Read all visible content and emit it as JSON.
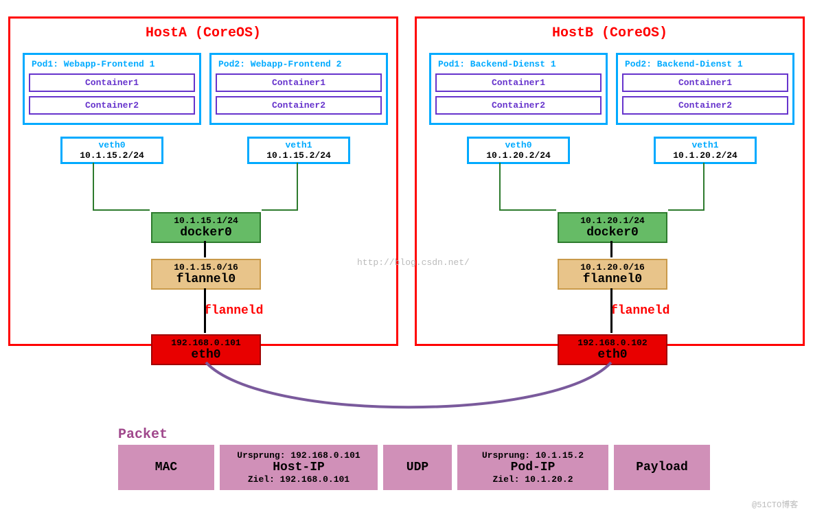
{
  "hostA": {
    "title": "HostA (CoreOS)",
    "pod1": {
      "title": "Pod1: Webapp-Frontend 1",
      "c1": "Container1",
      "c2": "Container2",
      "veth_name": "veth0",
      "veth_ip": "10.1.15.2/24"
    },
    "pod2": {
      "title": "Pod2: Webapp-Frontend 2",
      "c1": "Container1",
      "c2": "Container2",
      "veth_name": "veth1",
      "veth_ip": "10.1.15.2/24"
    },
    "docker0_ip": "10.1.15.1/24",
    "docker0_name": "docker0",
    "flannel0_ip": "10.1.15.0/16",
    "flannel0_name": "flannel0",
    "flanneld": "flanneld",
    "eth0_ip": "192.168.0.101",
    "eth0_name": "eth0"
  },
  "hostB": {
    "title": "HostB (CoreOS)",
    "pod1": {
      "title": "Pod1: Backend-Dienst 1",
      "c1": "Container1",
      "c2": "Container2",
      "veth_name": "veth0",
      "veth_ip": "10.1.20.2/24"
    },
    "pod2": {
      "title": "Pod2: Backend-Dienst 1",
      "c1": "Container1",
      "c2": "Container2",
      "veth_name": "veth1",
      "veth_ip": "10.1.20.2/24"
    },
    "docker0_ip": "10.1.20.1/24",
    "docker0_name": "docker0",
    "flannel0_ip": "10.1.20.0/16",
    "flannel0_name": "flannel0",
    "flanneld": "flanneld",
    "eth0_ip": "192.168.0.102",
    "eth0_name": "eth0"
  },
  "packet": {
    "label": "Packet",
    "mac": "MAC",
    "hostip_src": "Ursprung: 192.168.0.101",
    "hostip_name": "Host-IP",
    "hostip_dst": "Ziel: 192.168.0.101",
    "udp": "UDP",
    "podip_src": "Ursprung: 10.1.15.2",
    "podip_name": "Pod-IP",
    "podip_dst": "Ziel: 10.1.20.2",
    "payload": "Payload"
  },
  "watermark1": "http://blog.csdn.net/",
  "watermark2": "@51CTO博客"
}
